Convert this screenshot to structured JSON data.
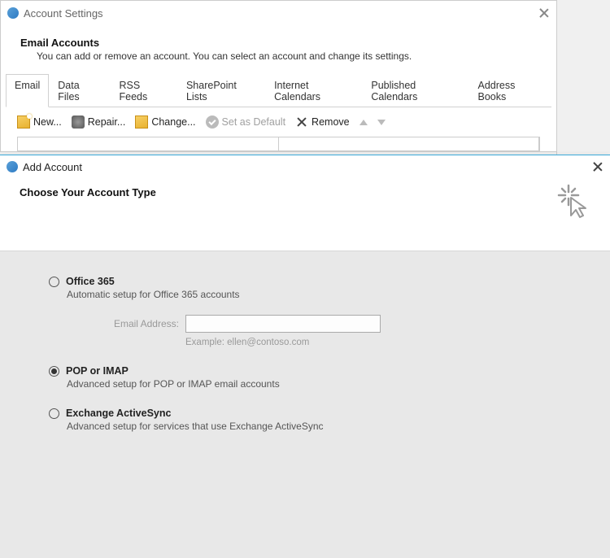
{
  "settings": {
    "title": "Account Settings",
    "section_title": "Email Accounts",
    "section_desc": "You can add or remove an account. You can select an account and change its settings.",
    "tabs": [
      "Email",
      "Data Files",
      "RSS Feeds",
      "SharePoint Lists",
      "Internet Calendars",
      "Published Calendars",
      "Address Books"
    ],
    "toolbar": {
      "new": "New...",
      "repair": "Repair...",
      "change": "Change...",
      "default": "Set as Default",
      "remove": "Remove"
    }
  },
  "add": {
    "title": "Add Account",
    "heading": "Choose Your Account Type",
    "options": [
      {
        "label": "Office 365",
        "desc": "Automatic setup for Office 365 accounts",
        "selected": false,
        "field_label": "Email Address:",
        "example": "Example: ellen@contoso.com"
      },
      {
        "label": "POP or IMAP",
        "desc": "Advanced setup for POP or IMAP email accounts",
        "selected": true
      },
      {
        "label": "Exchange ActiveSync",
        "desc": "Advanced setup for services that use Exchange ActiveSync",
        "selected": false
      }
    ]
  }
}
